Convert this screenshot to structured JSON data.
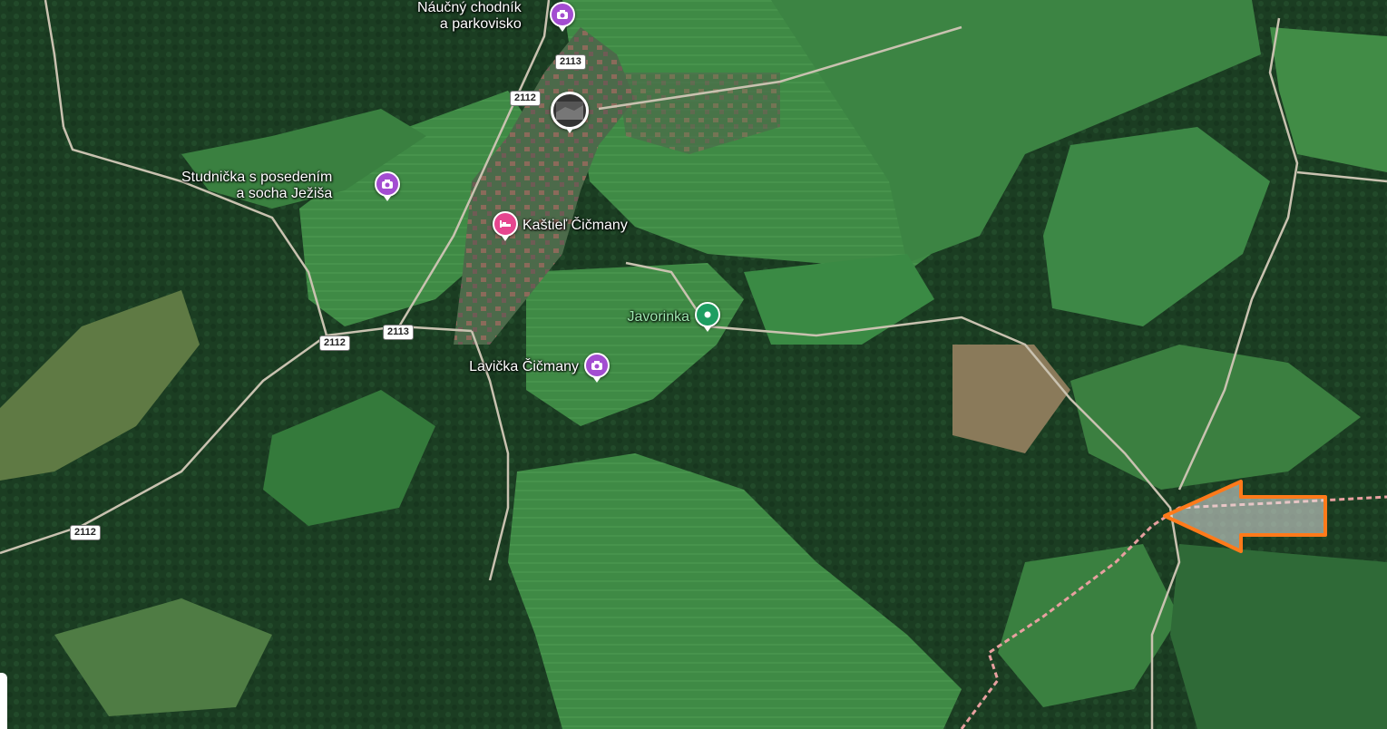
{
  "places": [
    {
      "id": "naucny",
      "label_lines": [
        "Náučný chodník",
        "a parkovisko"
      ],
      "type": "photo"
    },
    {
      "id": "studnicka",
      "label_lines": [
        "Studnička s posedením",
        "a socha Ježiša"
      ],
      "type": "photo"
    },
    {
      "id": "kastiel",
      "label_lines": [
        "Kaštieľ Čičmany"
      ],
      "type": "hotel"
    },
    {
      "id": "javorinka",
      "label_lines": [
        "Javorinka"
      ],
      "type": "park"
    },
    {
      "id": "lavicka",
      "label_lines": [
        "Lavička Čičmany"
      ],
      "type": "photo"
    }
  ],
  "road_shields": [
    "2113",
    "2112",
    "2113",
    "2112",
    "2112"
  ],
  "icons": {
    "photo": "camera-icon",
    "hotel": "bed-icon",
    "park": "park-pin-icon"
  },
  "colors": {
    "photo_pin": "#a34dd1",
    "hotel_pin": "#e6468f",
    "park_pin": "#1e9e62",
    "arrow": "#ff7a1a",
    "border_line": "#e8a0a0"
  }
}
